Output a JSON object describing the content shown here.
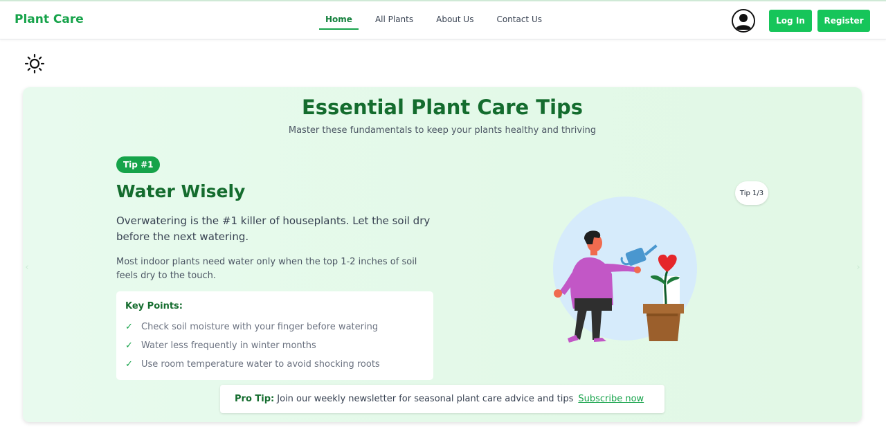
{
  "header": {
    "brand": "Plant Care",
    "nav": [
      "Home",
      "All Plants",
      "About Us",
      "Contact Us"
    ],
    "active_nav": "Home",
    "login_label": "Log In",
    "register_label": "Register"
  },
  "theme_toggle_icon": "sun-icon",
  "section": {
    "title": "Essential Plant Care Tips",
    "subtitle": "Master these fundamentals to keep your plants healthy and thriving"
  },
  "tip": {
    "badge": "Tip #1",
    "heading": "Water Wisely",
    "lead": "Overwatering is the #1 killer of houseplants. Let the soil dry before the next watering.",
    "detail": "Most indoor plants need water only when the top 1-2 inches of soil feels dry to the touch.",
    "key_points_title": "Key Points:",
    "key_points": [
      "Check soil moisture with your finger before watering",
      "Water less frequently in winter months",
      "Use room temperature water to avoid shocking roots"
    ],
    "counter": "Tip 1/3"
  },
  "carousel": {
    "slides": 3,
    "active": 0
  },
  "pro_tip": {
    "label": "Pro Tip:",
    "text": "Join our weekly newsletter for seasonal plant care advice and tips",
    "link": "Subscribe now"
  },
  "colors": {
    "brand_green": "#16a34a",
    "button_green": "#16c55a",
    "heading_green": "#146c2e",
    "card_bg": "#e3f9e8"
  }
}
